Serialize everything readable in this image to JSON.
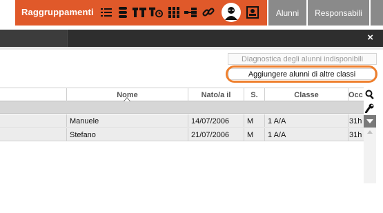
{
  "topbar": {
    "group_label": "Raggruppamenti",
    "accent_color": "#e0592a",
    "icons": [
      "list-icon",
      "stack-icon",
      "group-tables-icon",
      "group-clock-icon",
      "columns-icon",
      "tree-icon",
      "link-icon",
      "student-avatar-icon",
      "presentation-icon"
    ],
    "tabs": [
      {
        "label": "Alunni"
      },
      {
        "label": "Responsabili"
      },
      {
        "label": ""
      }
    ]
  },
  "dialog": {
    "close_glyph": "×",
    "buttons": {
      "diagnostics": "Diagnostica degli alunni indisponibili",
      "add_students": "Aggiungere alunni di altre classi"
    },
    "highlight_color": "#ee7f2d"
  },
  "table": {
    "columns": [
      {
        "label": ""
      },
      {
        "label": "Nome"
      },
      {
        "label": "Nato/a il"
      },
      {
        "label": "S."
      },
      {
        "label": "Classe"
      },
      {
        "label": "Occ"
      }
    ],
    "rows": [
      {
        "cognome": "",
        "nome": "Manuele",
        "nato": "14/07/2006",
        "sesso": "M",
        "classe": "1 A/A",
        "occ": "31h"
      },
      {
        "cognome": "",
        "nome": "Stefano",
        "nato": "21/07/2006",
        "sesso": "M",
        "classe": "1 A/A",
        "occ": "31h"
      }
    ]
  },
  "tools": [
    "search-icon",
    "wrench-icon",
    "filter-dropdown-icon"
  ]
}
